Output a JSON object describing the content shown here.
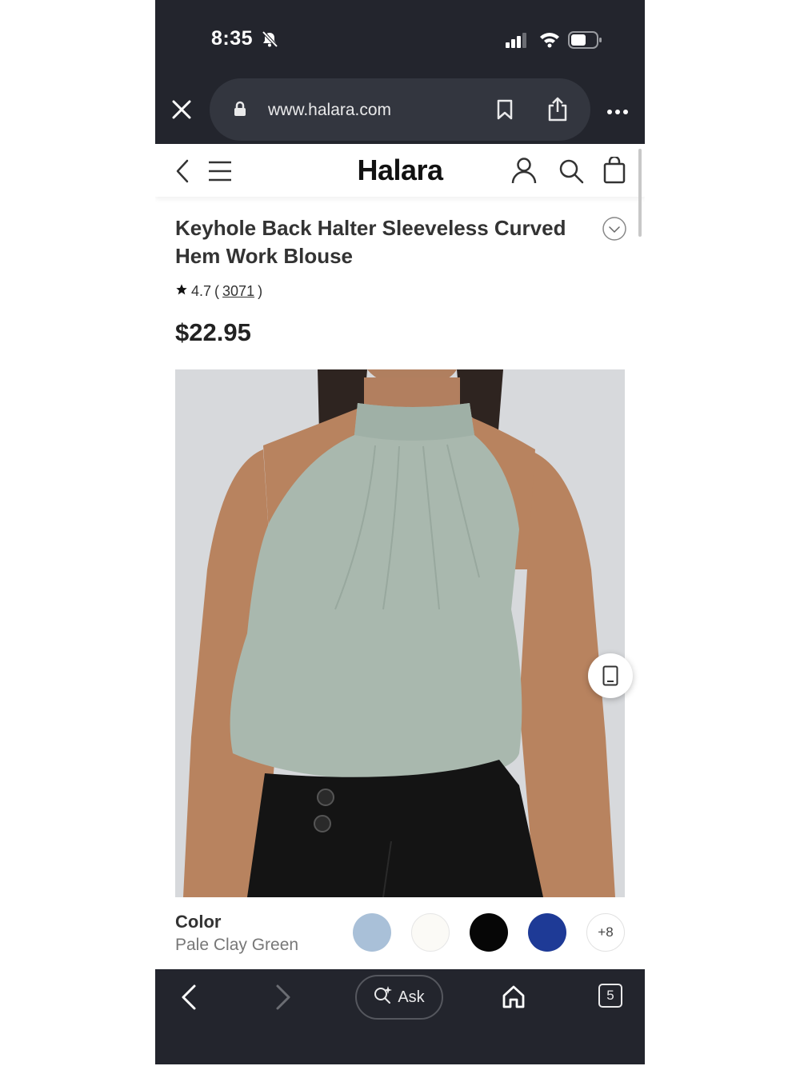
{
  "status": {
    "time": "8:35"
  },
  "browser": {
    "url": "www.halara.com"
  },
  "site": {
    "logo": "Halara"
  },
  "product": {
    "title": "Keyhole Back Halter Sleeveless Curved Hem Work Blouse",
    "rating": "4.7",
    "reviews": "3071",
    "price": "$22.95"
  },
  "color": {
    "label": "Color",
    "selected": "Pale Clay Green",
    "swatches": [
      {
        "name": "light-blue",
        "hex": "#a9c0d8"
      },
      {
        "name": "ivory",
        "hex": "#fbfaf6"
      },
      {
        "name": "black",
        "hex": "#060606"
      },
      {
        "name": "royal-blue",
        "hex": "#1e3a96"
      }
    ],
    "more": "+8"
  },
  "bottombar": {
    "ask_label": "Ask",
    "tabs_count": "5"
  },
  "colors": {
    "chrome": "#23252d",
    "pill": "#33363f",
    "blouse": "#a9b8ae"
  }
}
